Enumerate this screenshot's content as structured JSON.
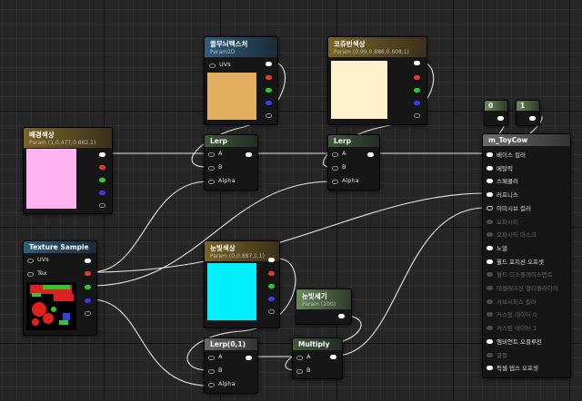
{
  "colors": {
    "wire": "#e6e6e6",
    "white_pin": "#ffffff",
    "red_pin": "#e23a2a",
    "green_pin": "#2ec82e",
    "blue_pin": "#3a3ae6",
    "gray_pin": "#9a9a9a"
  },
  "nodes": {
    "param2d": {
      "title": "줄무늬텍스처",
      "subtitle": "Param2D",
      "uvs": "UVs",
      "swatch": "#e0b060"
    },
    "param_cream": {
      "title": "코쥬빈색상",
      "subtitle": "Param (0.99,0.886,0.608,1)",
      "swatch": "#fef0cc"
    },
    "param_bg": {
      "title": "배경색상",
      "subtitle": "Param (1,0.477,0.862,1)",
      "swatch": "#ffb3f0"
    },
    "lerp1": {
      "title": "Lerp",
      "a": "A",
      "b": "B",
      "alpha": "Alpha"
    },
    "lerp2": {
      "title": "Lerp",
      "a": "A",
      "b": "B",
      "alpha": "Alpha"
    },
    "texsample": {
      "title": "Texture Sample",
      "uvs": "UVs",
      "tex": "Tex"
    },
    "param_eye": {
      "title": "눈빛색상",
      "subtitle": "Param (0,0.887,1,1)",
      "swatch": "#00f0ff"
    },
    "param_strength": {
      "title": "눈빛세기",
      "subtitle": "Param (100)"
    },
    "lerp3": {
      "title": "Lerp(0,1)",
      "a": "A",
      "b": "B",
      "alpha": "Alpha"
    },
    "multiply": {
      "title": "Multiply",
      "a": "A",
      "b": "B"
    },
    "const0": {
      "title": "0"
    },
    "const1": {
      "title": "1"
    },
    "material": {
      "title": "m_ToyCow",
      "inputs": [
        "베이스 컬러",
        "메탈릭",
        "스페큘러",
        "러프니스",
        "이미시브 컬러",
        "오파시티",
        "오파시티 마스크",
        "노멀",
        "월드 포지션 오프셋",
        "월드 디스플레이스먼트",
        "테셀레이션 멀티플라이어",
        "서브서피스 컬러",
        "커스텀 데이터 0",
        "커스텀 데이터 1",
        "앰비언트 오클루전",
        "굴절",
        "픽셀 뎁스 오프셋"
      ]
    }
  }
}
